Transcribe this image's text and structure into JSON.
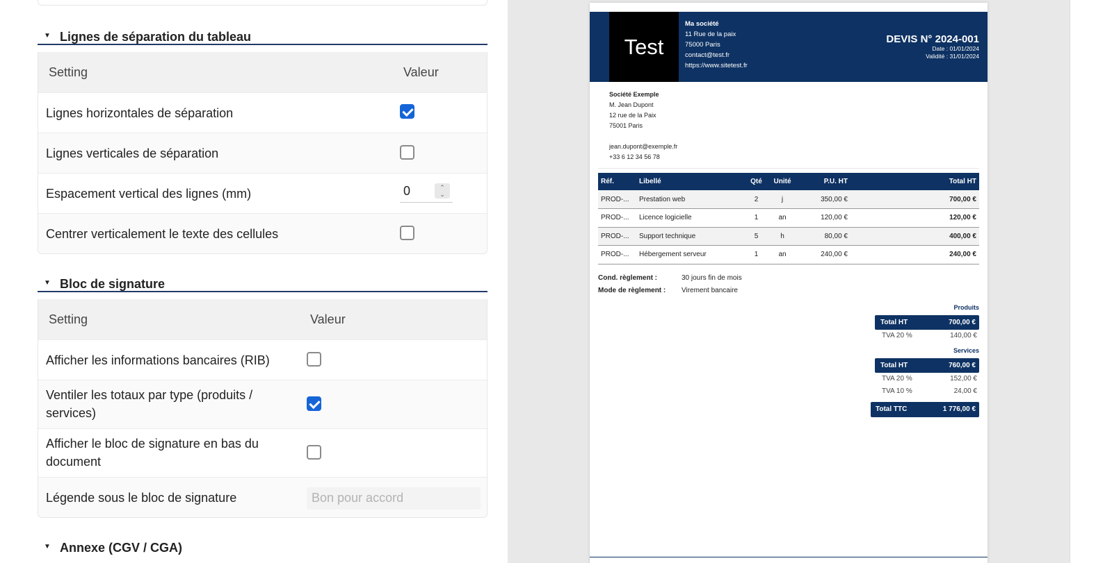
{
  "settings": {
    "table_lines": {
      "title": "Lignes de séparation du tableau",
      "col_setting": "Setting",
      "col_value": "Valeur",
      "rows": [
        {
          "label": "Lignes horizontales de séparation",
          "checked": true
        },
        {
          "label": "Lignes verticales de séparation",
          "checked": false
        },
        {
          "label": "Espacement vertical des lignes (mm)",
          "value": "0"
        },
        {
          "label": "Centrer verticalement le texte des cellules",
          "checked": false
        }
      ]
    },
    "signature": {
      "title": "Bloc de signature",
      "col_setting": "Setting",
      "col_value": "Valeur",
      "rows": [
        {
          "label": "Afficher les informations bancaires (RIB)",
          "checked": false
        },
        {
          "label": "Ventiler les totaux par type (produits / services)",
          "checked": true
        },
        {
          "label": "Afficher le bloc de signature en bas du document",
          "checked": false
        },
        {
          "label": "Légende sous le bloc de signature",
          "placeholder": "Bon pour accord"
        }
      ]
    },
    "annexe": {
      "title": "Annexe (CGV / CGA)"
    }
  },
  "preview": {
    "logo_text": "Test",
    "company": {
      "name": "Ma société",
      "address": "11 Rue de la paix",
      "city": "75000 Paris",
      "email": "contact@test.fr",
      "website": "https://www.sitetest.fr"
    },
    "quote": {
      "number": "DEVIS N° 2024-001",
      "date": "Date : 01/01/2024",
      "validity": "Validité : 31/01/2024"
    },
    "client": {
      "name": "Société Exemple",
      "contact": "M. Jean Dupont",
      "address": "12 rue de la Paix",
      "city": "75001 Paris",
      "email": "jean.dupont@exemple.fr",
      "phone": "+33 6 12 34 56 78"
    },
    "table": {
      "headers": {
        "ref": "Réf.",
        "label": "Libellé",
        "qty": "Qté",
        "unit": "Unité",
        "pu": "P.U. HT",
        "total": "Total HT"
      },
      "rows": [
        {
          "ref": "PROD-...",
          "label": "Prestation web",
          "qty": "2",
          "unit": "j",
          "pu": "350,00 €",
          "total": "700,00 €"
        },
        {
          "ref": "PROD-...",
          "label": "Licence logicielle",
          "qty": "1",
          "unit": "an",
          "pu": "120,00 €",
          "total": "120,00 €"
        },
        {
          "ref": "PROD-...",
          "label": "Support technique",
          "qty": "5",
          "unit": "h",
          "pu": "80,00 €",
          "total": "400,00 €"
        },
        {
          "ref": "PROD-...",
          "label": "Hébergement serveur",
          "qty": "1",
          "unit": "an",
          "pu": "240,00 €",
          "total": "240,00 €"
        }
      ]
    },
    "conditions": {
      "cond_label": "Cond. règlement :",
      "cond_value": "30 jours fin de mois",
      "mode_label": "Mode de règlement :",
      "mode_value": "Virement bancaire"
    },
    "totals": {
      "produits": {
        "title": "Produits",
        "ht_label": "Total HT",
        "ht_value": "700,00 €",
        "tva1_label": "TVA 20 %",
        "tva1_value": "140,00 €"
      },
      "services": {
        "title": "Services",
        "ht_label": "Total HT",
        "ht_value": "760,00 €",
        "tva1_label": "TVA 20 %",
        "tva1_value": "152,00 €",
        "tva2_label": "TVA 10 %",
        "tva2_value": "24,00 €"
      },
      "ttc_label": "Total TTC",
      "ttc_value": "1 776,00 €"
    }
  }
}
